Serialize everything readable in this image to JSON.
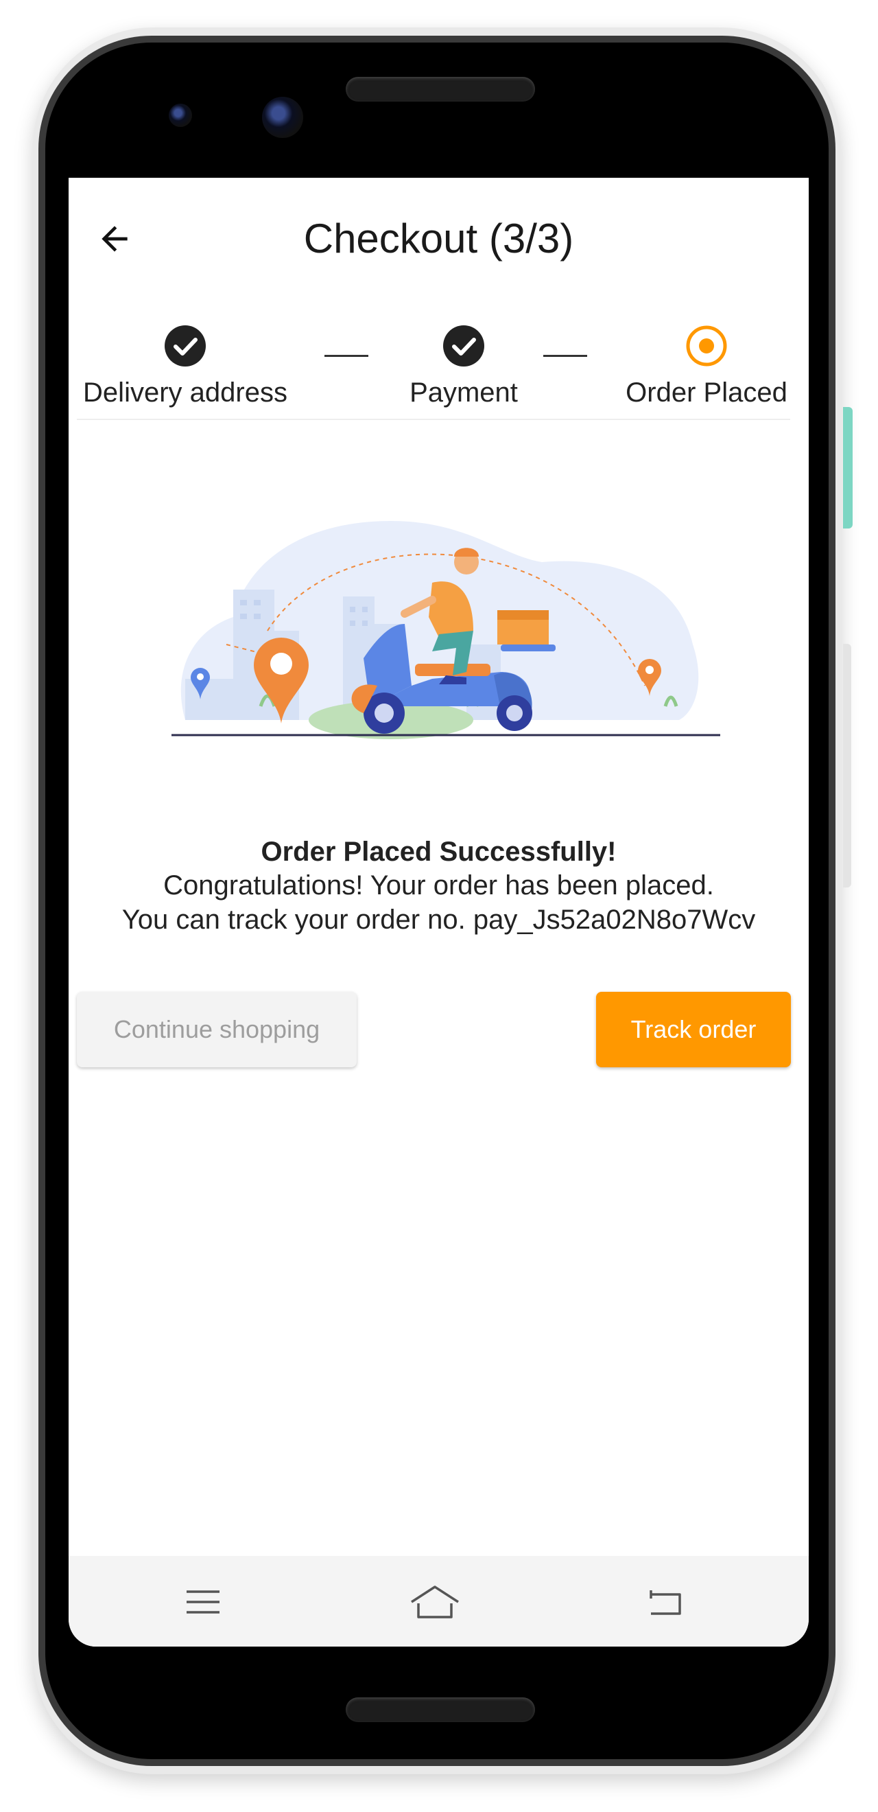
{
  "header": {
    "title": "Checkout (3/3)",
    "back_icon": "arrow-left-icon"
  },
  "stepper": {
    "steps": [
      {
        "label": "Delivery address",
        "state": "done",
        "icon": "check-circle-icon"
      },
      {
        "label": "Payment",
        "state": "done",
        "icon": "check-circle-icon"
      },
      {
        "label": "Order Placed",
        "state": "current",
        "icon": "radio-selected-icon"
      }
    ]
  },
  "message": {
    "title": "Order Placed Successfully!",
    "line1": "Congratulations! Your order has been placed.",
    "line2": "You can track your order no. pay_Js52a02N8o7Wcv"
  },
  "actions": {
    "continue_label": "Continue shopping",
    "track_label": "Track order"
  },
  "navbar": {
    "icons": [
      "menu-icon",
      "home-icon",
      "back-icon"
    ]
  },
  "colors": {
    "accent": "#ff9800",
    "check": "#222222",
    "secondary_button_bg": "#f3f3f3",
    "secondary_button_text": "#9d9d9d",
    "illustration_blue": "#5b86e5",
    "illustration_orange": "#f08a3c"
  }
}
